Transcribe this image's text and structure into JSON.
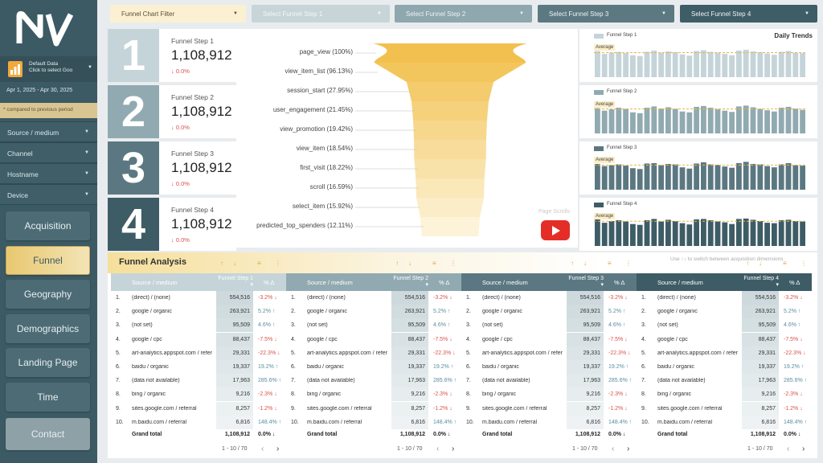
{
  "sidebar": {
    "datasource_line1": "Default Data",
    "datasource_line2": "Click to select Goo",
    "date_range": "Apr 1, 2025 - Apr 30, 2025",
    "compare_note": "* compared to previous period",
    "filters": [
      "Source / medium",
      "Channel",
      "Hostname",
      "Device"
    ],
    "nav": [
      "Acquisition",
      "Funnel",
      "Geography",
      "Demographics",
      "Landing Page",
      "Time",
      "Contact"
    ],
    "active_nav": "Funnel"
  },
  "topbar": {
    "filter": "Funnel Chart Filter",
    "step1": "Select Funnel Step 1",
    "step2": "Select Funnel Step 2",
    "step3": "Select Funnel Step 3",
    "step4": "Select Funnel Step 4"
  },
  "steps": [
    {
      "num": "1",
      "name": "Funnel Step 1",
      "value": "1,108,912",
      "change": "↓ 0.0%",
      "color": "#c5d4d9"
    },
    {
      "num": "2",
      "name": "Funnel Step 2",
      "value": "1,108,912",
      "change": "↓ 0.0%",
      "color": "#91aab1"
    },
    {
      "num": "3",
      "name": "Funnel Step 3",
      "value": "1,108,912",
      "change": "↓ 0.0%",
      "color": "#5b7882"
    },
    {
      "num": "4",
      "name": "Funnel Step 4",
      "value": "1,108,912",
      "change": "↓ 0.0%",
      "color": "#3e5c66"
    }
  ],
  "funnel": {
    "labels": [
      "page_view (100%)",
      "view_item_list (96.13%)",
      "session_start (27.95%)",
      "user_engagement (21.45%)",
      "view_promotion (19.42%)",
      "view_item (18.54%)",
      "first_visit (18.22%)",
      "scroll (16.59%)",
      "select_item (15.92%)",
      "predicted_top_spenders (12.11%)"
    ],
    "page_user": "Page Scrolls",
    "colors": {
      "top": "#f2c04e",
      "bottom": "#fdf3d8"
    }
  },
  "trends": {
    "title": "Daily Trends",
    "avg_label": "Average",
    "panels": [
      {
        "name": "Funnel Step 1",
        "color": "#c5d4d9",
        "values": [
          62,
          55,
          58,
          60,
          57,
          52,
          50,
          60,
          63,
          58,
          61,
          59,
          54,
          51,
          62,
          64,
          60,
          58,
          55,
          52,
          63,
          65,
          61,
          59,
          56,
          53,
          60,
          62,
          58,
          57
        ]
      },
      {
        "name": "Funnel Step 2",
        "color": "#91aab1",
        "values": [
          60,
          54,
          57,
          61,
          58,
          50,
          48,
          61,
          64,
          59,
          62,
          58,
          52,
          50,
          63,
          65,
          61,
          57,
          54,
          51,
          64,
          66,
          62,
          58,
          55,
          52,
          61,
          63,
          59,
          56
        ]
      },
      {
        "name": "Funnel Step 3",
        "color": "#5b7882",
        "values": [
          61,
          56,
          58,
          60,
          57,
          51,
          49,
          62,
          63,
          58,
          61,
          60,
          53,
          50,
          62,
          65,
          60,
          59,
          55,
          52,
          63,
          66,
          61,
          60,
          56,
          53,
          60,
          63,
          58,
          57
        ]
      },
      {
        "name": "Funnel Step 4",
        "color": "#3e5c66",
        "values": [
          63,
          55,
          59,
          61,
          58,
          52,
          50,
          61,
          64,
          58,
          62,
          59,
          54,
          51,
          63,
          64,
          61,
          58,
          56,
          52,
          64,
          65,
          62,
          59,
          55,
          54,
          61,
          62,
          59,
          58
        ]
      }
    ]
  },
  "analysis": {
    "title": "Funnel Analysis",
    "hint": "Use ↑↓ to switch between acquisition dimensions",
    "tables": [
      {
        "col1": "Source / medium",
        "col2": "Funnel Step 1 ▾",
        "col3": "% Δ",
        "hdr_bg": "#c5d4d9",
        "hdr_fg": "#ffffff"
      },
      {
        "col1": "Source / medium",
        "col2": "Funnel Step 2 ▾",
        "col3": "% Δ",
        "hdr_bg": "#91aab1",
        "hdr_fg": "#ffffff"
      },
      {
        "col1": "Source / medium",
        "col2": "Funnel Step 3 ▾",
        "col3": "% Δ",
        "hdr_bg": "#5b7882",
        "hdr_fg": "#ffffff"
      },
      {
        "col1": "Source / medium",
        "col2": "Funnel Step 4 ▾",
        "col3": "% Δ",
        "hdr_bg": "#3e5c66",
        "hdr_fg": "#ffffff"
      }
    ],
    "rows": [
      {
        "i": "1.",
        "s": "(direct) / (none)",
        "v": "554,516",
        "d": "-3.2% ↓",
        "dir": "dn"
      },
      {
        "i": "2.",
        "s": "google / organic",
        "v": "263,921",
        "d": "5.2% ↑",
        "dir": "up"
      },
      {
        "i": "3.",
        "s": "(not set)",
        "v": "95,509",
        "d": "4.6% ↑",
        "dir": "up"
      },
      {
        "i": "4.",
        "s": "google / cpc",
        "v": "88,437",
        "d": "-7.5% ↓",
        "dir": "dn"
      },
      {
        "i": "5.",
        "s": "art-analytics.appspot.com / referral",
        "v": "29,331",
        "d": "-22.3% ↓",
        "dir": "dn"
      },
      {
        "i": "6.",
        "s": "baidu / organic",
        "v": "19,337",
        "d": "19.2% ↑",
        "dir": "up"
      },
      {
        "i": "7.",
        "s": "(data not available)",
        "v": "17,963",
        "d": "285.6% ↑",
        "dir": "up"
      },
      {
        "i": "8.",
        "s": "bing / organic",
        "v": "9,216",
        "d": "-2.3% ↓",
        "dir": "dn"
      },
      {
        "i": "9.",
        "s": "sites.google.com / referral",
        "v": "8,257",
        "d": "-1.2% ↓",
        "dir": "dn"
      },
      {
        "i": "10.",
        "s": "m.baidu.com / referral",
        "v": "6,816",
        "d": "148.4% ↑",
        "dir": "up"
      }
    ],
    "total": {
      "s": "Grand total",
      "v": "1,108,912",
      "d": "0.0% ↓"
    },
    "pager": "1 - 10 / 70"
  }
}
